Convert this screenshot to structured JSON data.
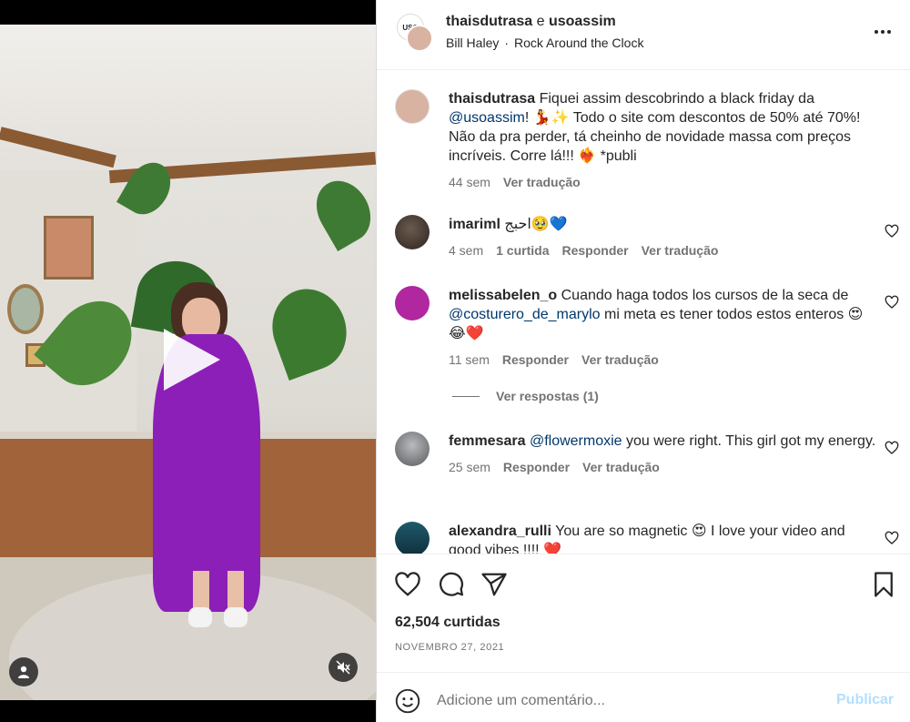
{
  "post": {
    "header": {
      "user1": "thaisdutrasa",
      "conj": "e",
      "user2": "usoassim",
      "avatar_text": "USO",
      "song_artist": "Bill Haley",
      "song_separator": "·",
      "song_title": "Rock Around the Clock"
    },
    "caption": {
      "user": "thaisdutrasa",
      "text_1": "Fiquei assim descobrindo a black friday da ",
      "mention": "@usoassim",
      "text_2": "! 💃✨ Todo o site com descontos de 50% até 70%! Não da pra perder, tá cheinho de novidade massa com preços incríveis. Corre lá!!! ❤️‍🔥 *publi",
      "time": "44 sem",
      "translate": "Ver tradução"
    },
    "comments": [
      {
        "user": "imariml",
        "text": "احبج🥹💙",
        "time": "4 sem",
        "likes": "1 curtida",
        "reply": "Responder",
        "translate": "Ver tradução"
      },
      {
        "user": "melissabelen_o",
        "text_1": "Cuando haga todos los cursos de la seca de ",
        "mention": "@costurero_de_marylo",
        "text_2": " mi meta es tener todos estos enteros 😍😂❤️",
        "time": "11 sem",
        "reply": "Responder",
        "translate": "Ver tradução",
        "view_replies": "Ver respostas (1)"
      },
      {
        "user": "femmesara",
        "mention": "@flowermoxie",
        "text_2": " you were right. This girl got my energy.",
        "time": "25 sem",
        "reply": "Responder",
        "translate": "Ver tradução"
      },
      {
        "user": "alexandra_rulli",
        "text": "You are so magnetic 😍 I love your video and good vibes !!!! ❤️"
      }
    ],
    "likes_count": "62,504 curtidas",
    "date": "NOVEMBRO 27, 2021",
    "comment_box": {
      "placeholder": "Adicione um comentário...",
      "publish": "Publicar"
    }
  },
  "icons": {
    "more": "more-horizontal-icon",
    "heart": "heart-icon",
    "comment": "comment-icon",
    "share": "share-icon",
    "save": "bookmark-icon",
    "emoji": "emoji-icon",
    "play": "play-icon",
    "user": "user-icon",
    "mute": "muted-speaker-icon"
  },
  "colors": {
    "mention": "#00376b",
    "publish_disabled": "#b2dffc",
    "secondary_text": "#737373",
    "dress": "#8c1fb8"
  }
}
